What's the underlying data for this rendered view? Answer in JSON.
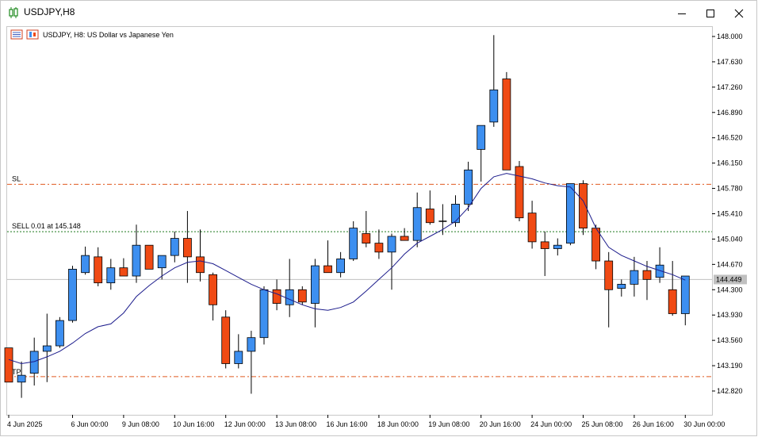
{
  "window": {
    "title": "USDJPY,H8",
    "minimize_icon": "minimize-icon",
    "maximize_icon": "maximize-icon",
    "close_icon": "close-icon"
  },
  "chart_header": {
    "text": "USDJPY, H8:  US Dollar vs Japanese Yen"
  },
  "colors": {
    "bull": "#3d8ff0",
    "bear": "#f04a14",
    "ma_line": "#1c1c8c",
    "sl_tp_line": "#e05a20",
    "sell_line": "#1f7a1f",
    "bid_line": "#c0c0c0",
    "bid_badge": "#c0c0c0"
  },
  "chart_data": {
    "type": "candlestick",
    "symbol": "USDJPY",
    "timeframe": "H8",
    "ylim": [
      142.66,
      148.06
    ],
    "y_ticks": [
      "148.000",
      "147.630",
      "147.260",
      "146.890",
      "146.520",
      "146.150",
      "145.780",
      "145.410",
      "145.040",
      "144.670",
      "144.300",
      "143.930",
      "143.560",
      "143.190",
      "142.820"
    ],
    "x_ticks": [
      {
        "label": "4 Jun 2025",
        "index": 0
      },
      {
        "label": "6 Jun 00:00",
        "index": 5
      },
      {
        "label": "9 Jun 08:00",
        "index": 9
      },
      {
        "label": "10 Jun 16:00",
        "index": 13
      },
      {
        "label": "12 Jun 00:00",
        "index": 17
      },
      {
        "label": "13 Jun 08:00",
        "index": 21
      },
      {
        "label": "16 Jun 16:00",
        "index": 25
      },
      {
        "label": "18 Jun 00:00",
        "index": 29
      },
      {
        "label": "19 Jun 08:00",
        "index": 33
      },
      {
        "label": "20 Jun 16:00",
        "index": 37
      },
      {
        "label": "24 Jun 00:00",
        "index": 41
      },
      {
        "label": "25 Jun 08:00",
        "index": 45
      },
      {
        "label": "26 Jun 16:00",
        "index": 49
      },
      {
        "label": "30 Jun 00:00",
        "index": 53
      }
    ],
    "candles": [
      {
        "o": 143.45,
        "h": 143.45,
        "l": 142.95,
        "c": 142.95
      },
      {
        "o": 142.95,
        "h": 143.25,
        "l": 142.72,
        "c": 143.05
      },
      {
        "o": 143.08,
        "h": 143.6,
        "l": 142.9,
        "c": 143.4
      },
      {
        "o": 143.4,
        "h": 143.95,
        "l": 142.95,
        "c": 143.48
      },
      {
        "o": 143.48,
        "h": 143.9,
        "l": 143.45,
        "c": 143.85
      },
      {
        "o": 143.85,
        "h": 144.65,
        "l": 143.82,
        "c": 144.6
      },
      {
        "o": 144.55,
        "h": 144.93,
        "l": 144.52,
        "c": 144.8
      },
      {
        "o": 144.78,
        "h": 144.92,
        "l": 144.35,
        "c": 144.4
      },
      {
        "o": 144.4,
        "h": 144.75,
        "l": 144.3,
        "c": 144.62
      },
      {
        "o": 144.62,
        "h": 144.76,
        "l": 144.5,
        "c": 144.5
      },
      {
        "o": 144.5,
        "h": 145.25,
        "l": 144.4,
        "c": 144.95
      },
      {
        "o": 144.95,
        "h": 144.95,
        "l": 144.6,
        "c": 144.6
      },
      {
        "o": 144.62,
        "h": 144.8,
        "l": 144.45,
        "c": 144.8
      },
      {
        "o": 144.8,
        "h": 145.15,
        "l": 144.7,
        "c": 145.05
      },
      {
        "o": 145.05,
        "h": 145.45,
        "l": 144.4,
        "c": 144.78
      },
      {
        "o": 144.78,
        "h": 145.18,
        "l": 144.42,
        "c": 144.55
      },
      {
        "o": 144.52,
        "h": 144.55,
        "l": 143.85,
        "c": 144.08
      },
      {
        "o": 143.9,
        "h": 144.0,
        "l": 143.15,
        "c": 143.22
      },
      {
        "o": 143.22,
        "h": 143.65,
        "l": 143.15,
        "c": 143.4
      },
      {
        "o": 143.4,
        "h": 143.7,
        "l": 142.78,
        "c": 143.6
      },
      {
        "o": 143.6,
        "h": 144.35,
        "l": 143.5,
        "c": 144.3
      },
      {
        "o": 144.3,
        "h": 144.45,
        "l": 144.0,
        "c": 144.1
      },
      {
        "o": 144.08,
        "h": 144.75,
        "l": 143.9,
        "c": 144.3
      },
      {
        "o": 144.3,
        "h": 144.35,
        "l": 144.08,
        "c": 144.12
      },
      {
        "o": 144.1,
        "h": 144.75,
        "l": 143.75,
        "c": 144.65
      },
      {
        "o": 144.65,
        "h": 145.02,
        "l": 144.55,
        "c": 144.55
      },
      {
        "o": 144.55,
        "h": 144.85,
        "l": 144.48,
        "c": 144.75
      },
      {
        "o": 144.75,
        "h": 145.3,
        "l": 144.72,
        "c": 145.2
      },
      {
        "o": 145.12,
        "h": 145.45,
        "l": 144.92,
        "c": 144.98
      },
      {
        "o": 144.98,
        "h": 145.18,
        "l": 144.75,
        "c": 144.85
      },
      {
        "o": 144.85,
        "h": 145.12,
        "l": 144.3,
        "c": 145.08
      },
      {
        "o": 145.08,
        "h": 145.2,
        "l": 145.02,
        "c": 145.02
      },
      {
        "o": 145.02,
        "h": 145.72,
        "l": 144.92,
        "c": 145.5
      },
      {
        "o": 145.48,
        "h": 145.75,
        "l": 145.25,
        "c": 145.28
      },
      {
        "o": 145.3,
        "h": 145.55,
        "l": 145.1,
        "c": 145.3
      },
      {
        "o": 145.28,
        "h": 145.68,
        "l": 145.22,
        "c": 145.55
      },
      {
        "o": 145.55,
        "h": 146.17,
        "l": 145.45,
        "c": 146.05
      },
      {
        "o": 146.35,
        "h": 146.7,
        "l": 145.88,
        "c": 146.7
      },
      {
        "o": 146.75,
        "h": 148.02,
        "l": 146.68,
        "c": 147.22
      },
      {
        "o": 147.38,
        "h": 147.48,
        "l": 146.05,
        "c": 146.05
      },
      {
        "o": 146.1,
        "h": 146.18,
        "l": 145.3,
        "c": 145.35
      },
      {
        "o": 145.42,
        "h": 145.6,
        "l": 144.9,
        "c": 145.0
      },
      {
        "o": 145.0,
        "h": 145.15,
        "l": 144.5,
        "c": 144.9
      },
      {
        "o": 144.9,
        "h": 145.05,
        "l": 144.8,
        "c": 144.95
      },
      {
        "o": 144.98,
        "h": 145.85,
        "l": 144.95,
        "c": 145.85
      },
      {
        "o": 145.85,
        "h": 145.9,
        "l": 145.1,
        "c": 145.2
      },
      {
        "o": 145.2,
        "h": 145.25,
        "l": 144.6,
        "c": 144.72
      },
      {
        "o": 144.72,
        "h": 144.85,
        "l": 143.75,
        "c": 144.3
      },
      {
        "o": 144.32,
        "h": 144.45,
        "l": 144.2,
        "c": 144.38
      },
      {
        "o": 144.38,
        "h": 144.78,
        "l": 144.2,
        "c": 144.58
      },
      {
        "o": 144.58,
        "h": 144.72,
        "l": 144.15,
        "c": 144.45
      },
      {
        "o": 144.48,
        "h": 144.92,
        "l": 144.4,
        "c": 144.66
      },
      {
        "o": 144.3,
        "h": 144.72,
        "l": 143.92,
        "c": 143.95
      },
      {
        "o": 143.95,
        "h": 144.5,
        "l": 143.78,
        "c": 144.5
      }
    ],
    "ma_line": [
      143.28,
      143.22,
      143.25,
      143.32,
      143.4,
      143.52,
      143.66,
      143.76,
      143.8,
      143.96,
      144.2,
      144.36,
      144.5,
      144.62,
      144.7,
      144.72,
      144.68,
      144.58,
      144.48,
      144.38,
      144.3,
      144.24,
      144.16,
      144.08,
      144.02,
      144.0,
      144.04,
      144.12,
      144.28,
      144.45,
      144.62,
      144.82,
      144.98,
      145.08,
      145.18,
      145.3,
      145.5,
      145.78,
      145.95,
      146.0,
      145.96,
      145.92,
      145.86,
      145.82,
      145.8,
      145.6,
      145.2,
      144.92,
      144.8,
      144.72,
      144.64,
      144.58,
      144.52,
      144.44
    ],
    "levels": {
      "sl": {
        "label": "SL",
        "price": 145.84
      },
      "sell": {
        "label": "SELL 0.01 at 145.148",
        "price": 145.148
      },
      "tp": {
        "label": "TP",
        "price": 143.03
      },
      "bid": {
        "label": "144.449",
        "price": 144.449
      }
    }
  }
}
